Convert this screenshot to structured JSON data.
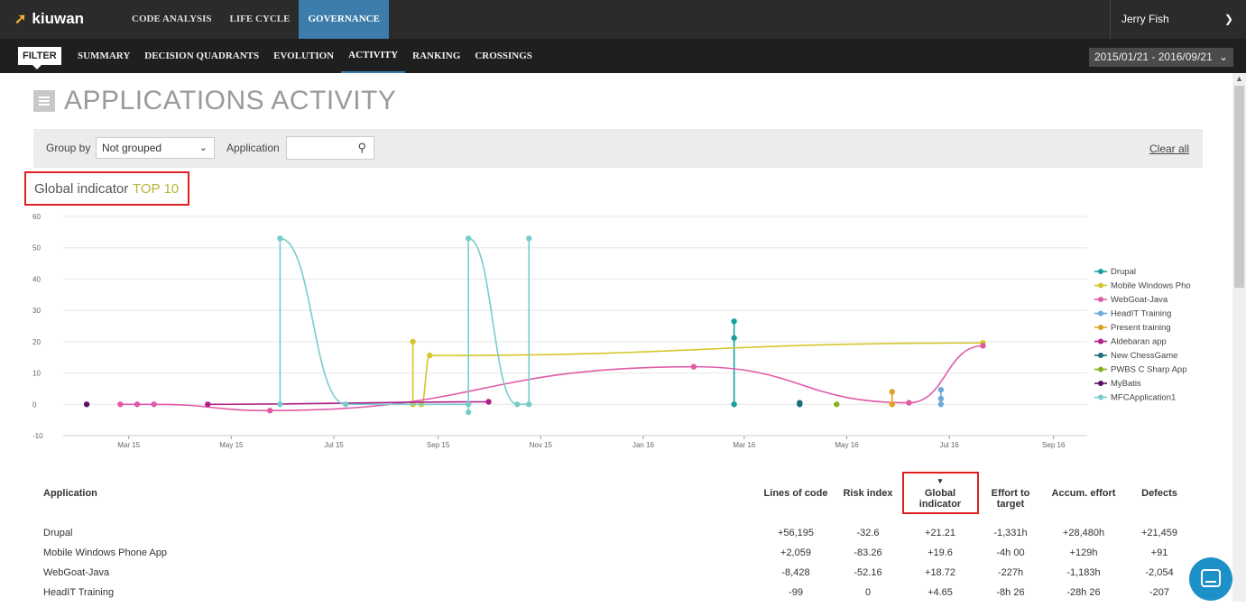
{
  "app": {
    "brand": "kiuwan",
    "user": "Jerry Fish"
  },
  "topnav": {
    "items": [
      "CODE ANALYSIS",
      "LIFE CYCLE",
      "GOVERNANCE"
    ],
    "active": 2
  },
  "subnav": {
    "filter": "FILTER",
    "items": [
      "SUMMARY",
      "DECISION QUADRANTS",
      "EVOLUTION",
      "ACTIVITY",
      "RANKING",
      "CROSSINGS"
    ],
    "active": 3
  },
  "daterange": "2015/01/21 - 2016/09/21",
  "page": {
    "title": "APPLICATIONS ACTIVITY"
  },
  "filters": {
    "group_by_label": "Group by",
    "group_by_value": "Not grouped",
    "application_label": "Application",
    "application_value": "",
    "clear_all": "Clear all"
  },
  "indicator": {
    "label": "Global indicator",
    "top": "TOP 10"
  },
  "chart_data": {
    "type": "line",
    "ylim": [
      -10,
      60
    ],
    "yticks": [
      60,
      50,
      40,
      30,
      20,
      10,
      0,
      -10
    ],
    "xticks": [
      "Mar 15",
      "May 15",
      "Jul 15",
      "Sep 15",
      "Nov 15",
      "Jan 16",
      "Mar 16",
      "May 16",
      "Jul 16",
      "Sep 16"
    ],
    "legend_position": "right",
    "series": [
      {
        "name": "Drupal",
        "color": "#1a9e9e",
        "points": [
          [
            "2016-02-24",
            26.5
          ],
          [
            "2016-02-24",
            21.2
          ],
          [
            "2016-02-24",
            0
          ]
        ]
      },
      {
        "name": "Mobile Windows Pho",
        "color": "#d4c72b",
        "points": [
          [
            "2015-08-17",
            20
          ],
          [
            "2015-08-17",
            0
          ],
          [
            "2015-08-22",
            0
          ],
          [
            "2015-08-27",
            15.6
          ],
          [
            "2016-07-21",
            19.6
          ]
        ]
      },
      {
        "name": "WebGoat-Java",
        "color": "#e05aa8",
        "points": [
          [
            "2015-02-24",
            0
          ],
          [
            "2015-03-06",
            0
          ],
          [
            "2015-03-16",
            0
          ],
          [
            "2015-05-24",
            -2
          ],
          [
            "2016-01-31",
            12
          ],
          [
            "2016-06-07",
            0.5
          ],
          [
            "2016-07-21",
            18.7
          ]
        ]
      },
      {
        "name": "HeadIT Training",
        "color": "#6aaad8",
        "points": [
          [
            "2016-06-26",
            4.65
          ],
          [
            "2016-06-26",
            1.8
          ],
          [
            "2016-06-26",
            0
          ]
        ]
      },
      {
        "name": "Present training",
        "color": "#e0a020",
        "points": [
          [
            "2016-05-28",
            4
          ],
          [
            "2016-05-28",
            0
          ]
        ]
      },
      {
        "name": "Aldebaran app",
        "color": "#b0208a",
        "points": [
          [
            "2015-04-17",
            0
          ],
          [
            "2015-10-01",
            0.8
          ]
        ]
      },
      {
        "name": "New ChessGame",
        "color": "#1a6e80",
        "points": [
          [
            "2016-04-03",
            0.5
          ],
          [
            "2016-04-03",
            0
          ]
        ]
      },
      {
        "name": "PWBS C Sharp App",
        "color": "#8ab020",
        "points": [
          [
            "2016-04-25",
            0
          ]
        ]
      },
      {
        "name": "MyBatis",
        "color": "#5a1060",
        "points": [
          [
            "2015-02-04",
            0
          ]
        ]
      },
      {
        "name": "MFCApplication1",
        "color": "#78cccc",
        "points": [
          [
            "2015-05-30",
            0
          ],
          [
            "2015-05-30",
            53
          ],
          [
            "2015-07-08",
            0
          ],
          [
            "2015-09-19",
            0
          ],
          [
            "2015-09-19",
            -2.5
          ],
          [
            "2015-09-19",
            53
          ],
          [
            "2015-10-18",
            0
          ],
          [
            "2015-10-25",
            0
          ],
          [
            "2015-10-25",
            53
          ],
          [
            "2015-10-25",
            0
          ]
        ]
      }
    ]
  },
  "table": {
    "headers": {
      "app": "Application",
      "loc": "Lines of code",
      "risk": "Risk index",
      "gi": "Global indicator",
      "effort": "Effort to target",
      "accum": "Accum. effort",
      "defects": "Defects"
    },
    "sort_indicator": "▾",
    "rows": [
      {
        "app": "Drupal",
        "loc": "+56,195",
        "risk": "-32.6",
        "gi": "+21.21",
        "effort": "-1,331h",
        "accum": "+28,480h",
        "defects": "+21,459"
      },
      {
        "app": "Mobile Windows Phone App",
        "loc": "+2,059",
        "risk": "-83.26",
        "gi": "+19.6",
        "effort": "-4h 00",
        "accum": "+129h",
        "defects": "+91"
      },
      {
        "app": "WebGoat-Java",
        "loc": "-8,428",
        "risk": "-52.16",
        "gi": "+18.72",
        "effort": "-227h",
        "accum": "-1,183h",
        "defects": "-2,054"
      },
      {
        "app": "HeadIT Training",
        "loc": "-99",
        "risk": "0",
        "gi": "+4.65",
        "effort": "-8h 26",
        "accum": "-28h 26",
        "defects": "-207"
      }
    ]
  }
}
